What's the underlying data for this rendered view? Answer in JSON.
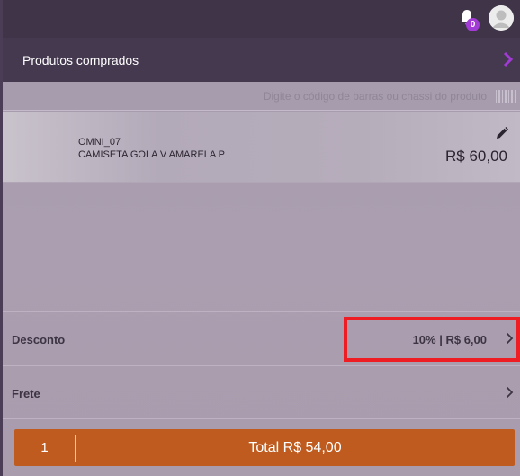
{
  "topbar": {
    "notification_count": "0",
    "icons": [
      "bell-icon",
      "avatar-icon"
    ]
  },
  "header": {
    "title": "Produtos comprados",
    "accent_color": "#a23ad6"
  },
  "search": {
    "placeholder": "Digite o código de barras ou chassi do produto"
  },
  "product": {
    "code": "OMNI_07",
    "name": "CAMISETA GOLA V AMARELA P",
    "price": "R$ 60,00"
  },
  "discount": {
    "label": "Desconto",
    "value": "10% | R$ 6,00"
  },
  "shipping": {
    "label": "Frete"
  },
  "footer": {
    "quantity": "1",
    "total": "Total R$ 54,00",
    "button_color": "#bf5b1f"
  }
}
